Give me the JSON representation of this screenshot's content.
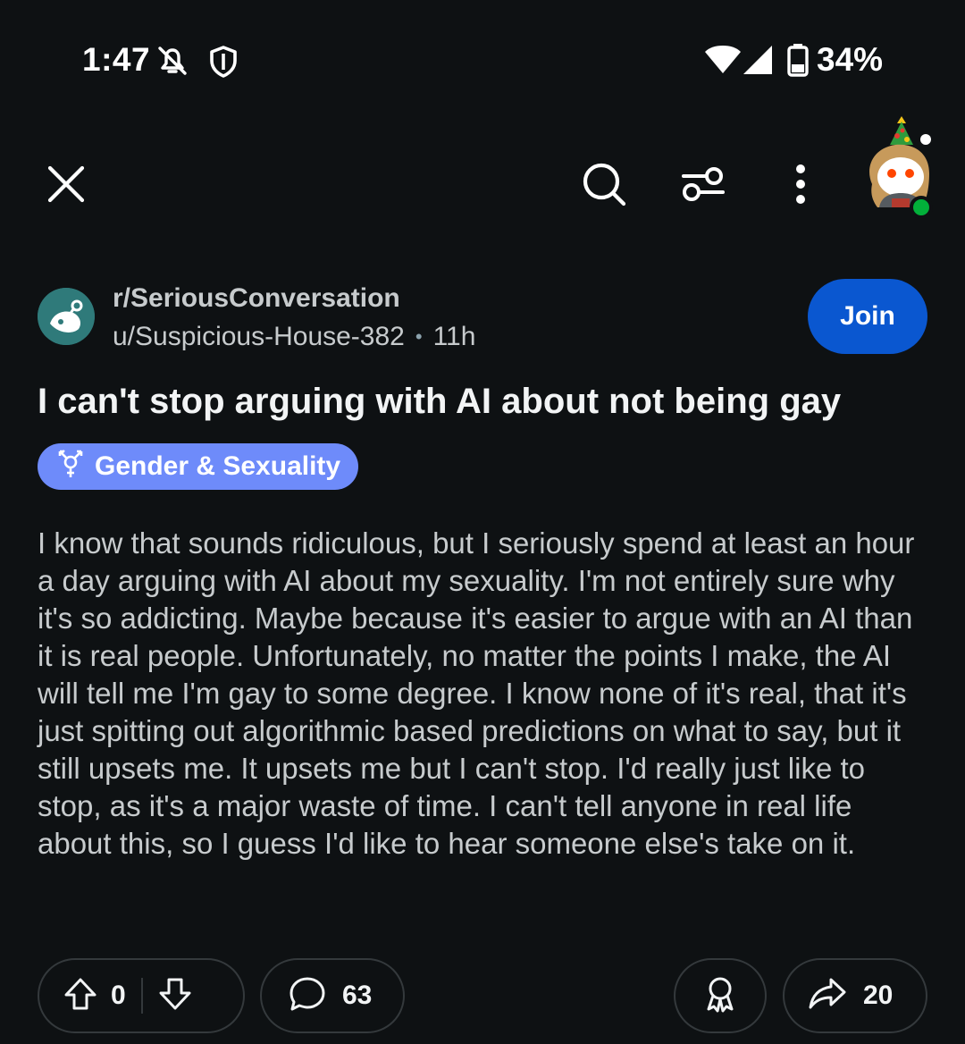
{
  "status_bar": {
    "time": "1:47",
    "battery": "34%",
    "icons": [
      "notifications-off-icon",
      "shield-icon",
      "wifi-icon",
      "signal-icon",
      "battery-icon"
    ]
  },
  "top_bar": {
    "icons": [
      "close-icon",
      "search-icon",
      "filter-icon",
      "more-vert-icon",
      "profile-avatar"
    ]
  },
  "post": {
    "subreddit": "r/SeriousConversation",
    "author": "u/Suspicious-House-382",
    "separator": "•",
    "age": "11h",
    "join_label": "Join",
    "title": "I can't stop arguing with AI about not being gay",
    "flair": "Gender & Sexuality",
    "body": "I know that sounds ridiculous, but I seriously spend at least an hour a day arguing with AI about my sexuality. I'm not entirely sure why it's so addicting. Maybe because it's easier to argue with an AI than it is real people. Unfortunately, no matter the points I make, the AI will tell me I'm gay to some degree. I know none of it's real, that it's just spitting out algorithmic based predictions on what to say, but it still upsets me. It upsets me but I can't stop. I'd really just like to stop, as it's a major waste of time. I can't tell anyone in real life about this, so I guess I'd like to hear someone else's take on it."
  },
  "actions": {
    "vote_count": "0",
    "comment_count": "63",
    "share_count": "20"
  },
  "colors": {
    "background": "#0e1113",
    "join_button": "#0a57d0",
    "flair": "#6e8bfa",
    "online": "#02b03a"
  }
}
